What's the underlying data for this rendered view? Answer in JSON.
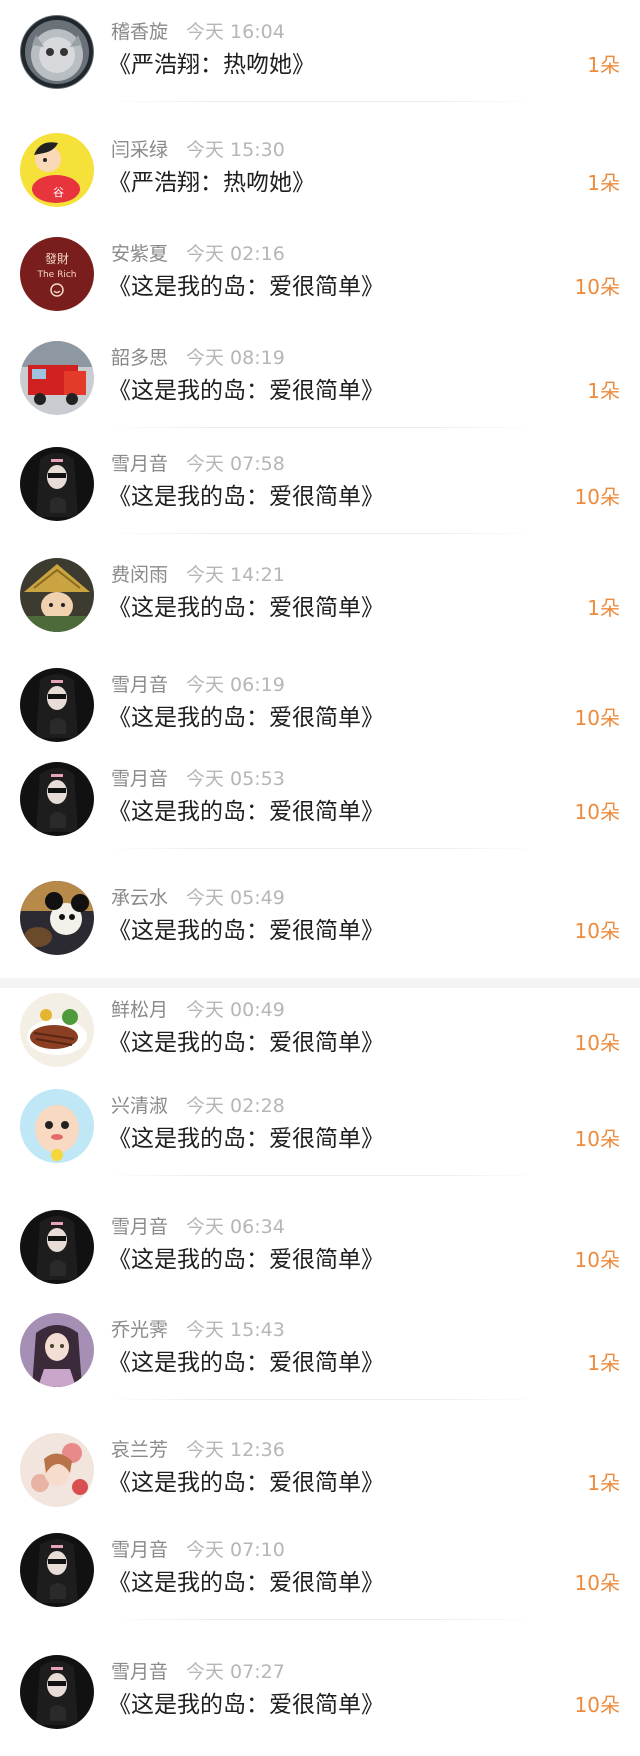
{
  "gifts": [
    {
      "name": "稽香旋",
      "time": "今天 16:04",
      "title": "《严浩翔：热吻她》",
      "count": "1朵",
      "avatar": "cat-avatar"
    },
    {
      "name": "闫采绿",
      "time": "今天 15:30",
      "title": "《严浩翔：热吻她》",
      "count": "1朵",
      "avatar": "cartoon-boy-avatar"
    },
    {
      "name": "安紫夏",
      "time": "今天 02:16",
      "title": "《这是我的岛：爱很简单》",
      "count": "10朵",
      "avatar": "the-rich-logo-avatar",
      "avatar_text_top": "發財",
      "avatar_text_bottom": "The Rich"
    },
    {
      "name": "韶多思",
      "time": "今天 08:19",
      "title": "《这是我的岛：爱很简单》",
      "count": "1朵",
      "avatar": "fire-truck-avatar"
    },
    {
      "name": "雪月音",
      "time": "今天 07:58",
      "title": "《这是我的岛：爱很简单》",
      "count": "10朵",
      "avatar": "dark-hair-girl-avatar"
    },
    {
      "name": "费闵雨",
      "time": "今天 14:21",
      "title": "《这是我的岛：爱很简单》",
      "count": "1朵",
      "avatar": "straw-hat-avatar"
    },
    {
      "name": "雪月音",
      "time": "今天 06:19",
      "title": "《这是我的岛：爱很简单》",
      "count": "10朵",
      "avatar": "dark-hair-girl-avatar"
    },
    {
      "name": "雪月音",
      "time": "今天 05:53",
      "title": "《这是我的岛：爱很简单》",
      "count": "10朵",
      "avatar": "dark-hair-girl-avatar"
    },
    {
      "name": "承云水",
      "time": "今天 05:49",
      "title": "《这是我的岛：爱很简单》",
      "count": "10朵",
      "avatar": "cartoon-mouse-avatar"
    },
    {
      "name": "鲜松月",
      "time": "今天 00:49",
      "title": "《这是我的岛：爱很简单》",
      "count": "10朵",
      "avatar": "steak-avatar"
    },
    {
      "name": "兴清淑",
      "time": "今天 02:28",
      "title": "《这是我的岛：爱很简单》",
      "count": "10朵",
      "avatar": "cartoon-face-avatar"
    },
    {
      "name": "雪月音",
      "time": "今天 06:34",
      "title": "《这是我的岛：爱很简单》",
      "count": "10朵",
      "avatar": "dark-hair-girl-avatar"
    },
    {
      "name": "乔光霁",
      "time": "今天 15:43",
      "title": "《这是我的岛：爱很简单》",
      "count": "1朵",
      "avatar": "anime-girl-avatar"
    },
    {
      "name": "哀兰芳",
      "time": "今天 12:36",
      "title": "《这是我的岛：爱很简单》",
      "count": "1朵",
      "avatar": "flower-girl-avatar"
    },
    {
      "name": "雪月音",
      "time": "今天 07:10",
      "title": "《这是我的岛：爱很简单》",
      "count": "10朵",
      "avatar": "dark-hair-girl-avatar"
    },
    {
      "name": "雪月音",
      "time": "今天 07:27",
      "title": "《这是我的岛：爱很简单》",
      "count": "10朵",
      "avatar": "dark-hair-girl-avatar"
    }
  ],
  "colors": {
    "count": "#ee8a3b",
    "name": "#8a8a8a",
    "time": "#b6b6b6",
    "title": "#1f1f1f"
  }
}
